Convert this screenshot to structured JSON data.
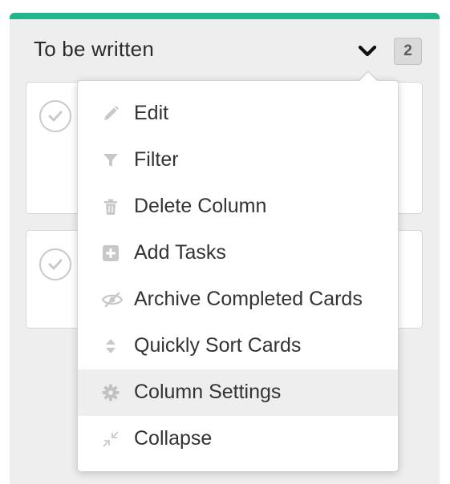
{
  "column": {
    "title": "To be written",
    "count": "2",
    "accent_color": "#22b48a"
  },
  "cards": [
    {
      "completed": false
    },
    {
      "completed": false
    }
  ],
  "menu": {
    "items": [
      {
        "label": "Edit",
        "icon": "pencil-icon"
      },
      {
        "label": "Filter",
        "icon": "filter-icon"
      },
      {
        "label": "Delete Column",
        "icon": "trash-icon"
      },
      {
        "label": "Add Tasks",
        "icon": "plus-square-icon"
      },
      {
        "label": "Archive Completed Cards",
        "icon": "eye-slash-icon"
      },
      {
        "label": "Quickly Sort Cards",
        "icon": "sort-icon"
      },
      {
        "label": "Column Settings",
        "icon": "gear-icon",
        "highlighted": true
      },
      {
        "label": "Collapse",
        "icon": "compress-icon"
      }
    ]
  }
}
